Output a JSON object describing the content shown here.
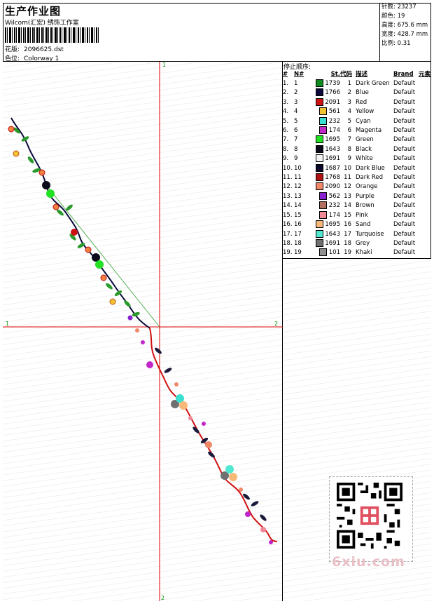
{
  "header": {
    "title": "生产作业图",
    "subtitle": "Wilcom(汇宏) 绣饰工作室",
    "design_label": "花版:",
    "design_value": "2096625.dst",
    "colorway_label": "色位:",
    "colorway_value": "Colorway 1"
  },
  "stats": {
    "stitches_label": "针数:",
    "stitches_value": "23237",
    "colors_label": "颜色:",
    "colors_value": "19",
    "height_label": "高度:",
    "height_value": "675.6 mm",
    "width_label": "宽度:",
    "width_value": "428.7 mm",
    "scale_label": "比例:",
    "scale_value": "0.31"
  },
  "preview": {
    "axis_top": "1",
    "axis_left": "1",
    "axis_right": "2",
    "axis_bottom": "2"
  },
  "stop_table": {
    "title": "停止顺序:",
    "headers": [
      "#",
      "N#",
      "St.",
      "代码",
      "描述",
      "Brand",
      "元素"
    ],
    "rows": [
      {
        "idx": "1.",
        "n": "1",
        "st": "1739",
        "code": "1",
        "desc": "Dark Green",
        "brand": "Default",
        "color": "#0f8a1e"
      },
      {
        "idx": "2.",
        "n": "2",
        "st": "1766",
        "code": "2",
        "desc": "Blue",
        "brand": "Default",
        "color": "#0a0a3a"
      },
      {
        "idx": "3.",
        "n": "3",
        "st": "2091",
        "code": "3",
        "desc": "Red",
        "brand": "Default",
        "color": "#cc1111"
      },
      {
        "idx": "4.",
        "n": "4",
        "st": "561",
        "code": "4",
        "desc": "Yellow",
        "brand": "Default",
        "color": "#f1c232"
      },
      {
        "idx": "5.",
        "n": "5",
        "st": "232",
        "code": "5",
        "desc": "Cyan",
        "brand": "Default",
        "color": "#38e0d0"
      },
      {
        "idx": "6.",
        "n": "6",
        "st": "174",
        "code": "6",
        "desc": "Magenta",
        "brand": "Default",
        "color": "#c026c8"
      },
      {
        "idx": "7.",
        "n": "7",
        "st": "1695",
        "code": "7",
        "desc": "Green",
        "brand": "Default",
        "color": "#22e022"
      },
      {
        "idx": "8.",
        "n": "8",
        "st": "1643",
        "code": "8",
        "desc": "Black",
        "brand": "Default",
        "color": "#0a0a1a"
      },
      {
        "idx": "9.",
        "n": "9",
        "st": "1691",
        "code": "9",
        "desc": "White",
        "brand": "Default",
        "color": "#f4f4f4"
      },
      {
        "idx": "10.",
        "n": "10",
        "st": "1687",
        "code": "10",
        "desc": "Dark Blue",
        "brand": "Default",
        "color": "#0a0a2a"
      },
      {
        "idx": "11.",
        "n": "11",
        "st": "1768",
        "code": "11",
        "desc": "Dark Red",
        "brand": "Default",
        "color": "#b01010"
      },
      {
        "idx": "12.",
        "n": "12",
        "st": "2090",
        "code": "12",
        "desc": "Orange",
        "brand": "Default",
        "color": "#f08868"
      },
      {
        "idx": "13.",
        "n": "13",
        "st": "562",
        "code": "13",
        "desc": "Purple",
        "brand": "Default",
        "color": "#8820d0"
      },
      {
        "idx": "14.",
        "n": "14",
        "st": "232",
        "code": "14",
        "desc": "Brown",
        "brand": "Default",
        "color": "#b07060"
      },
      {
        "idx": "15.",
        "n": "15",
        "st": "174",
        "code": "15",
        "desc": "Pink",
        "brand": "Default",
        "color": "#f08898"
      },
      {
        "idx": "16.",
        "n": "16",
        "st": "1695",
        "code": "16",
        "desc": "Sand",
        "brand": "Default",
        "color": "#f8b878"
      },
      {
        "idx": "17.",
        "n": "17",
        "st": "1643",
        "code": "17",
        "desc": "Turquoise",
        "brand": "Default",
        "color": "#50e8d0"
      },
      {
        "idx": "18.",
        "n": "18",
        "st": "1691",
        "code": "18",
        "desc": "Grey",
        "brand": "Default",
        "color": "#707070"
      },
      {
        "idx": "19.",
        "n": "19",
        "st": "101",
        "code": "19",
        "desc": "Khaki",
        "brand": "Default",
        "color": "#909090"
      }
    ]
  },
  "watermark": {
    "text": "6xiu.com"
  }
}
